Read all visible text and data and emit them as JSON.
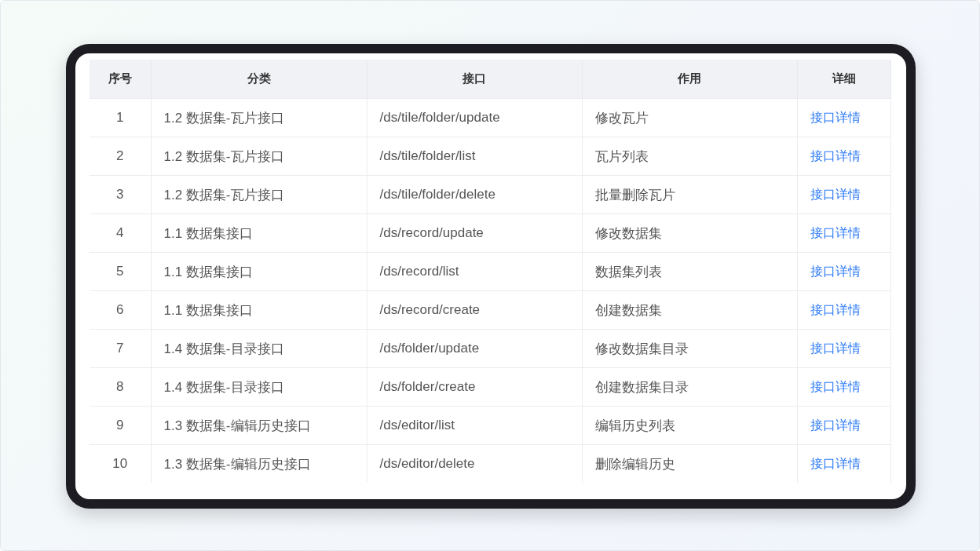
{
  "table": {
    "columns": [
      "序号",
      "分类",
      "接口",
      "作用",
      "详细"
    ],
    "rows": [
      {
        "index": "1",
        "category": "1.2 数据集-瓦片接口",
        "endpoint": "/ds/tile/folder/update",
        "purpose": "修改瓦片",
        "detail": "接口详情"
      },
      {
        "index": "2",
        "category": "1.2 数据集-瓦片接口",
        "endpoint": "/ds/tile/folder/list",
        "purpose": "瓦片列表",
        "detail": "接口详情"
      },
      {
        "index": "3",
        "category": "1.2 数据集-瓦片接口",
        "endpoint": "/ds/tile/folder/delete",
        "purpose": "批量删除瓦片",
        "detail": "接口详情"
      },
      {
        "index": "4",
        "category": "1.1 数据集接口",
        "endpoint": "/ds/record/update",
        "purpose": "修改数据集",
        "detail": "接口详情"
      },
      {
        "index": "5",
        "category": "1.1 数据集接口",
        "endpoint": "/ds/record/list",
        "purpose": "数据集列表",
        "detail": "接口详情"
      },
      {
        "index": "6",
        "category": "1.1 数据集接口",
        "endpoint": "/ds/record/create",
        "purpose": "创建数据集",
        "detail": "接口详情"
      },
      {
        "index": "7",
        "category": "1.4 数据集-目录接口",
        "endpoint": "/ds/folder/update",
        "purpose": "修改数据集目录",
        "detail": "接口详情"
      },
      {
        "index": "8",
        "category": "1.4 数据集-目录接口",
        "endpoint": "/ds/folder/create",
        "purpose": "创建数据集目录",
        "detail": "接口详情"
      },
      {
        "index": "9",
        "category": "1.3 数据集-编辑历史接口",
        "endpoint": "/ds/editor/list",
        "purpose": "编辑历史列表",
        "detail": "接口详情"
      },
      {
        "index": "10",
        "category": "1.3 数据集-编辑历史接口",
        "endpoint": "/ds/editor/delete",
        "purpose": "删除编辑历史",
        "detail": "接口详情"
      }
    ]
  }
}
